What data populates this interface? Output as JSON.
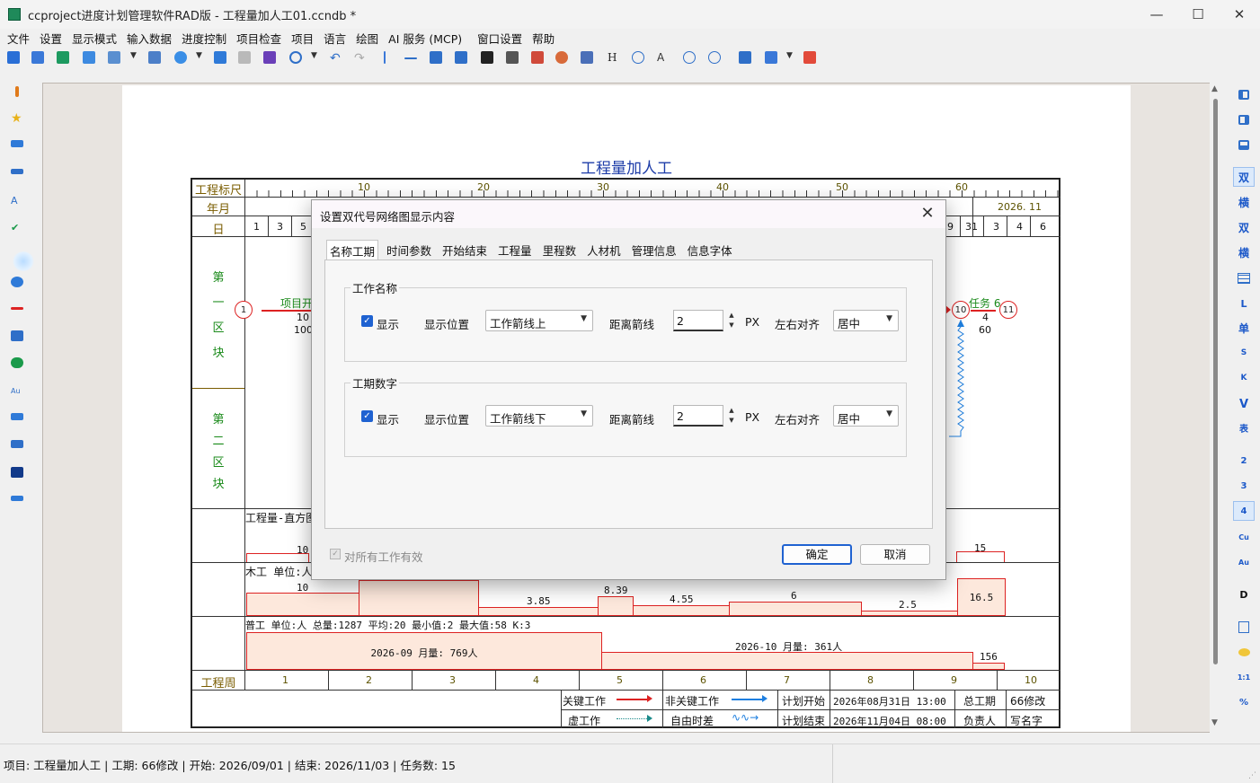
{
  "window": {
    "title": "ccproject进度计划管理软件RAD版 - 工程量加人工01.ccndb *",
    "minimize": "—",
    "maximize": "☐",
    "close": "✕"
  },
  "menu": [
    "文件",
    "设置",
    "显示模式",
    "输入数据",
    "进度控制",
    "项目检查",
    "项目",
    "语言",
    "绘图",
    "AI 服务 (MCP)",
    "窗口设置",
    "帮助"
  ],
  "right_toolbar": [
    "双",
    "横",
    "双",
    "横",
    "L",
    "单",
    "S",
    "K",
    "V",
    "表",
    "2",
    "3",
    "4",
    "Cu",
    "Au",
    "D",
    "1:1",
    "%"
  ],
  "chart": {
    "title": "工程量加人工",
    "ruler_label": "工程标尺",
    "ruler_ticks": [
      "10",
      "20",
      "30",
      "40",
      "50",
      "60"
    ],
    "month_label": "年月",
    "month_right": "2026. 11",
    "day_label": "日",
    "days_left": [
      "1",
      "3",
      "5"
    ],
    "days_right": [
      "9",
      "31",
      "3",
      "4",
      "6"
    ],
    "section1": [
      "第",
      "一",
      "区",
      "块"
    ],
    "section2": [
      "第",
      "二",
      "区",
      "块"
    ],
    "task1_name": "项目开",
    "task1_dur": "10",
    "task1_qty": "100",
    "task6_name": "任务 6",
    "task6_dur": "4",
    "task6_qty": "60",
    "node_1": "1",
    "node_10": "10",
    "node_11": "11",
    "hist1_label": "工程量-直方图",
    "hist1_left": "10",
    "hist1_right": "15",
    "hist2_label": "木工 单位:人",
    "hist2_values": [
      "10",
      "3.85",
      "8.39",
      "4.55",
      "6",
      "2.5",
      "16.5"
    ],
    "hist3_label": "普工 单位:人 总量:1287 平均:20 最小值:2 最大值:58 K:3",
    "hist3_sep": "2026-09 月量: 769人",
    "hist3_oct": "2026-10 月量: 361人",
    "hist3_right": "156",
    "week_label": "工程周",
    "weeks": [
      "1",
      "2",
      "3",
      "4",
      "5",
      "6",
      "7",
      "8",
      "9",
      "10"
    ],
    "legend_key": "关键工作",
    "legend_nonkey": "非关键工作",
    "legend_dummy": "虚工作",
    "legend_float": "自由时差",
    "plan_start_label": "计划开始",
    "plan_start": "2026年08月31日  13:00",
    "plan_end_label": "计划结束",
    "plan_end": "2026年11月04日  08:00",
    "total_label": "总工期",
    "total_value": "66修改",
    "owner_label": "负责人",
    "owner_value": "写名字"
  },
  "dialog": {
    "title": "设置双代号网络图显示内容",
    "tabs": [
      "名称工期",
      "时间参数",
      "开始结束",
      "工程量",
      "里程数",
      "人材机",
      "管理信息",
      "信息字体"
    ],
    "group1": {
      "legend": "工作名称",
      "show": "显示",
      "position_label": "显示位置",
      "position_value": "工作箭线上",
      "distance_label": "距离箭线",
      "distance_value": "2",
      "unit": "PX",
      "align_label": "左右对齐",
      "align_value": "居中"
    },
    "group2": {
      "legend": "工期数字",
      "show": "显示",
      "position_label": "显示位置",
      "position_value": "工作箭线下",
      "distance_label": "距离箭线",
      "distance_value": "2",
      "unit": "PX",
      "align_label": "左右对齐",
      "align_value": "居中"
    },
    "apply_all": "对所有工作有效",
    "ok": "确定",
    "cancel": "取消"
  },
  "status": "项目: 工程量加人工 | 工期: 66修改 | 开始: 2026/09/01 | 结束: 2026/11/03 | 任务数: 15",
  "colors": {
    "critical": "#dd2222",
    "noncritical": "#1e7fe0",
    "accent": "#1f62d1"
  }
}
